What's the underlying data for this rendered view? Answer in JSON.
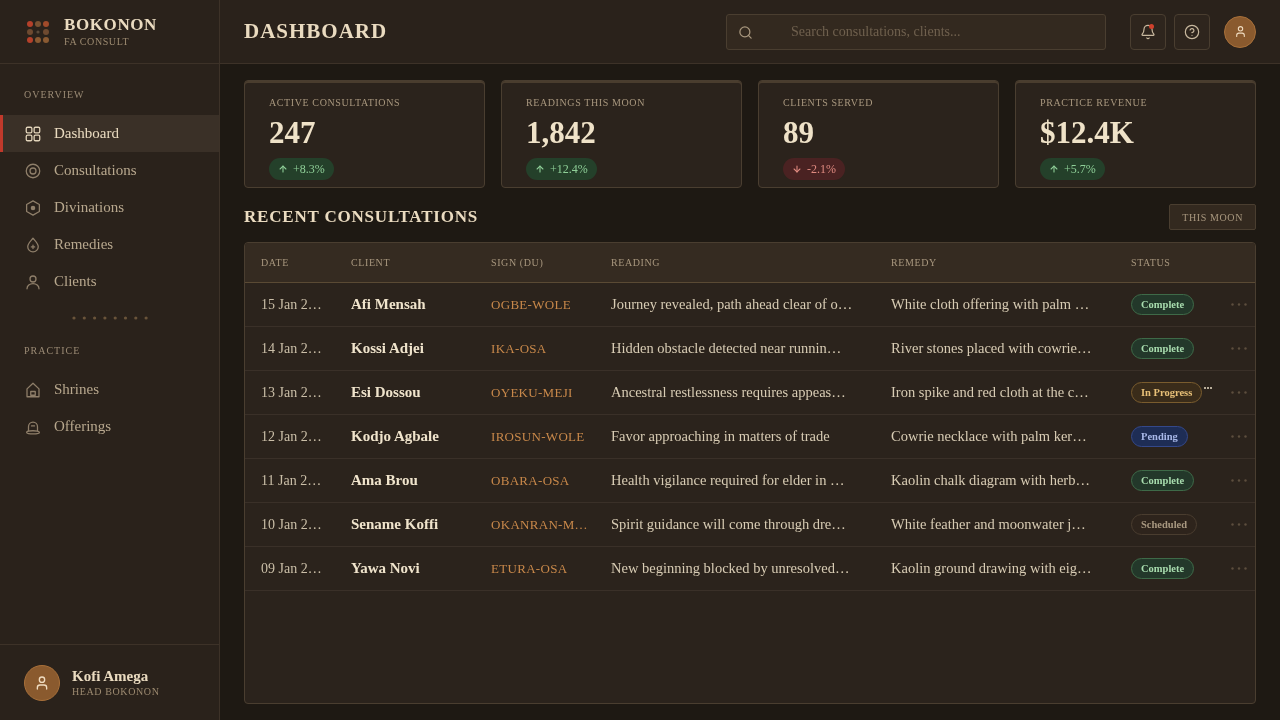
{
  "sidebar": {
    "brand": {
      "name": "BOKONON",
      "tagline": "FA CONSULT"
    },
    "sections": [
      {
        "label": "OVERVIEW",
        "items": [
          {
            "label": "Dashboard",
            "selected": true
          },
          {
            "label": "Consultations",
            "selected": false
          },
          {
            "label": "Divinations",
            "selected": false
          },
          {
            "label": "Remedies",
            "selected": false
          },
          {
            "label": "Clients",
            "selected": false
          }
        ]
      },
      {
        "label": "PRACTICE",
        "items": [
          {
            "label": "Shrines",
            "selected": false
          },
          {
            "label": "Offerings",
            "selected": false
          }
        ]
      }
    ],
    "user": {
      "name": "Kofi Amega",
      "role": "HEAD BOKONON"
    }
  },
  "header": {
    "title": "DASHBOARD",
    "search": {
      "placeholder": "Search consultations, clients..."
    },
    "notifications_unread": true
  },
  "stats": [
    {
      "label": "ACTIVE CONSULTATIONS",
      "value": "247",
      "change": "+8.3%",
      "kind": "up"
    },
    {
      "label": "READINGS THIS MOON",
      "value": "1,842",
      "change": "+12.4%",
      "kind": "up"
    },
    {
      "label": "CLIENTS SERVED",
      "value": "89",
      "change": "-2.1%",
      "kind": "down"
    },
    {
      "label": "PRACTICE REVENUE",
      "value": "$12.4K",
      "change": "+5.7%",
      "kind": "up"
    }
  ],
  "recent": {
    "title": "RECENT CONSULTATIONS",
    "filter": "THIS MOON",
    "columns": [
      "DATE",
      "CLIENT",
      "SIGN (DU)",
      "READING",
      "REMEDY",
      "STATUS"
    ],
    "rows": [
      {
        "date": "15 Jan 2…",
        "client": "Afi Mensah",
        "sign": "OGBE-WOLE",
        "reading": "Journey revealed, path ahead clear of o…",
        "remedy": "White cloth offering with palm …",
        "status": {
          "label": "Complete",
          "kind": "complete",
          "trailing_ellipsis": false
        }
      },
      {
        "date": "14 Jan 2…",
        "client": "Kossi Adjei",
        "sign": "IKA-OSA",
        "reading": "Hidden obstacle detected near runnin…",
        "remedy": "River stones placed with cowrie…",
        "status": {
          "label": "Complete",
          "kind": "complete",
          "trailing_ellipsis": false
        }
      },
      {
        "date": "13 Jan 2…",
        "client": "Esi Dossou",
        "sign": "OYEKU-MEJI",
        "reading": "Ancestral restlessness requires appeas…",
        "remedy": "Iron spike and red cloth at the c…",
        "status": {
          "label": "In Progress",
          "kind": "in_progress",
          "trailing_ellipsis": true
        }
      },
      {
        "date": "12 Jan 2…",
        "client": "Kodjo Agbale",
        "sign": "IROSUN-WOLE",
        "reading": "Favor approaching in matters of trade",
        "remedy": "Cowrie necklace with palm ker…",
        "status": {
          "label": "Pending",
          "kind": "pending",
          "trailing_ellipsis": false
        }
      },
      {
        "date": "11 Jan 2…",
        "client": "Ama Brou",
        "sign": "OBARA-OSA",
        "reading": "Health vigilance required for elder in …",
        "remedy": "Kaolin chalk diagram with herb…",
        "status": {
          "label": "Complete",
          "kind": "complete",
          "trailing_ellipsis": false
        }
      },
      {
        "date": "10 Jan 2…",
        "client": "Sename Koffi",
        "sign": "OKANRAN-M…",
        "reading": "Spirit guidance will come through dre…",
        "remedy": "White feather and moonwater j…",
        "status": {
          "label": "Scheduled",
          "kind": "scheduled",
          "trailing_ellipsis": false
        }
      },
      {
        "date": "09 Jan 2…",
        "client": "Yawa Novi",
        "sign": "ETURA-OSA",
        "reading": "New beginning blocked by unresolved…",
        "remedy": "Kaolin ground drawing with eig…",
        "status": {
          "label": "Complete",
          "kind": "complete",
          "trailing_ellipsis": false
        }
      }
    ]
  }
}
